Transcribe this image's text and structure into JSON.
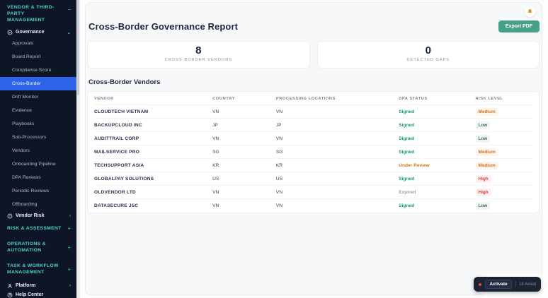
{
  "sidebar": {
    "section_title": "VENDOR & THIRD-PARTY MANAGEMENT",
    "collapse_icon": "−",
    "governance": {
      "label": "Governance",
      "chevron": "⌄"
    },
    "items": [
      "Approvals",
      "Board Report",
      "Compliance Score",
      "Cross-Border",
      "Drift Monitor",
      "Evidence",
      "Playbooks",
      "Sub-Processors",
      "Vendors",
      "Onboarding Pipeline",
      "DPA Reviews",
      "Periodic Reviews",
      "Offboarding"
    ],
    "active_item": "Cross-Border",
    "vendor_risk": {
      "label": "Vendor Risk",
      "chevron": "›"
    },
    "collapsed_sections": [
      {
        "label": "RISK & ASSESSMENT",
        "expand_icon": "+"
      },
      {
        "label": "OPERATIONS & AUTOMATION",
        "expand_icon": "+"
      },
      {
        "label": "TASK & WORKFLOW MANAGEMENT",
        "expand_icon": "+"
      }
    ],
    "platform": {
      "label": "Platform",
      "chevron": "›"
    },
    "help_center": {
      "label": "Help Center"
    }
  },
  "header": {
    "title": "Cross-Border Governance Report",
    "export_button": "Export PDF"
  },
  "stats": [
    {
      "value": "8",
      "label": "CROSS-BORDER VENDORS"
    },
    {
      "value": "0",
      "label": "DETECTED GAPS"
    }
  ],
  "vendors_table": {
    "section_title": "Cross-Border Vendors",
    "columns": [
      "VENDOR",
      "COUNTRY",
      "PROCESSING LOCATIONS",
      "DPA STATUS",
      "RISK LEVEL"
    ],
    "rows": [
      {
        "vendor": "CLOUDTECH VIETNAM",
        "country": "VN",
        "processing_locations": "VN",
        "dpa_status": "Signed",
        "risk_level": "Medium"
      },
      {
        "vendor": "BACKUPCLOUD INC",
        "country": "JP",
        "processing_locations": "JP",
        "dpa_status": "Signed",
        "risk_level": "Low"
      },
      {
        "vendor": "AUDITTRAIL CORP",
        "country": "VN",
        "processing_locations": "VN",
        "dpa_status": "Signed",
        "risk_level": "Low"
      },
      {
        "vendor": "MAILSERVICE PRO",
        "country": "SG",
        "processing_locations": "SG",
        "dpa_status": "Signed",
        "risk_level": "Medium"
      },
      {
        "vendor": "TECHSUPPORT ASIA",
        "country": "KR",
        "processing_locations": "KR",
        "dpa_status": "Under Review",
        "risk_level": "Medium"
      },
      {
        "vendor": "GLOBALPAY SOLUTIONS",
        "country": "US",
        "processing_locations": "US",
        "dpa_status": "Signed",
        "risk_level": "High"
      },
      {
        "vendor": "OLDVENDOR LTD",
        "country": "VN",
        "processing_locations": "VN",
        "dpa_status": "Expired",
        "risk_level": "High"
      },
      {
        "vendor": "DATASECURE JSC",
        "country": "VN",
        "processing_locations": "VN",
        "dpa_status": "Signed",
        "risk_level": "Low"
      }
    ]
  },
  "assist_widget": {
    "activate_label": "Activate",
    "assist_label": "UI Assist"
  },
  "colors": {
    "sidebar_bg": "#0d1526",
    "accent_teal": "#4fd1c5",
    "active_blue": "#2c63e8",
    "export_green": "#47a188",
    "signed_green": "#1d9b72",
    "review_orange": "#d07a1f",
    "expired_gray": "#9aa3af",
    "risk_low": "#3c6b5f",
    "risk_medium": "#cd7227",
    "risk_high": "#d64242",
    "bell_gold": "#c9941e",
    "status_dot_red": "#e14b4b"
  }
}
